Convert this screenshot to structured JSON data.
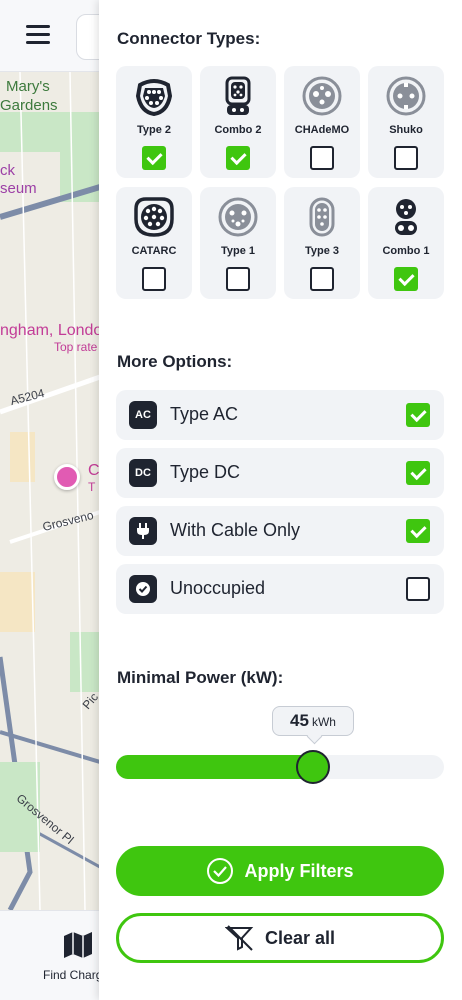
{
  "map": {
    "labels": [
      "Mary's",
      "Gardens",
      "ck",
      "seum",
      "ngham, Londo",
      "Top rate",
      "A5204",
      "Grosveno",
      "C",
      "T",
      "Pic",
      "Grosvenor Pl"
    ]
  },
  "bottom_nav": {
    "find_label": "Find Charg"
  },
  "filters": {
    "connector_title": "Connector Types:",
    "connectors": [
      {
        "name": "Type 2",
        "checked": true,
        "icon": "type2-connector-icon"
      },
      {
        "name": "Combo 2",
        "checked": true,
        "icon": "combo2-connector-icon"
      },
      {
        "name": "CHAdeMO",
        "checked": false,
        "icon": "chademo-connector-icon"
      },
      {
        "name": "Shuko",
        "checked": false,
        "icon": "shuko-connector-icon"
      },
      {
        "name": "CATARC",
        "checked": false,
        "icon": "catarc-connector-icon"
      },
      {
        "name": "Type 1",
        "checked": false,
        "icon": "type1-connector-icon"
      },
      {
        "name": "Type 3",
        "checked": false,
        "icon": "type3-connector-icon"
      },
      {
        "name": "Combo 1",
        "checked": true,
        "icon": "combo1-connector-icon"
      }
    ],
    "more_title": "More Options:",
    "options": [
      {
        "badge": "AC",
        "label": "Type AC",
        "checked": true
      },
      {
        "badge": "DC",
        "label": "Type DC",
        "checked": true
      },
      {
        "badge": "",
        "label": "With Cable Only",
        "checked": true,
        "icon": "plug-icon"
      },
      {
        "badge": "",
        "label": "Unoccupied",
        "checked": false,
        "icon": "check-circle-icon"
      }
    ],
    "power_title": "Minimal Power (kW):",
    "power": {
      "value": "45",
      "unit": "kWh",
      "fraction": 0.6
    },
    "apply_label": "Apply Filters",
    "clear_label": "Clear all"
  },
  "colors": {
    "accent": "#3fc60f",
    "dark": "#1f2430",
    "card": "#f1f3f6"
  }
}
